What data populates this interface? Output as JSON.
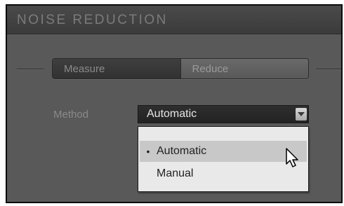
{
  "panel": {
    "title": "NOISE REDUCTION"
  },
  "segmented": {
    "items": [
      {
        "label": "Measure",
        "selected": false
      },
      {
        "label": "Reduce",
        "selected": true
      }
    ]
  },
  "method": {
    "label": "Method",
    "selected_value": "Automatic",
    "options": [
      {
        "label": "Automatic",
        "selected": true,
        "bullet": "•"
      },
      {
        "label": "Manual",
        "selected": false
      }
    ]
  },
  "icons": {
    "dropdown_arrow": "chevron-down-icon",
    "pointer": "mouse-cursor-icon"
  },
  "colors": {
    "panel_bg": "#595959",
    "header_bg": "#3f3f3f",
    "menu_bg": "#e9e9e9",
    "menu_highlight": "#c8c8c8"
  }
}
